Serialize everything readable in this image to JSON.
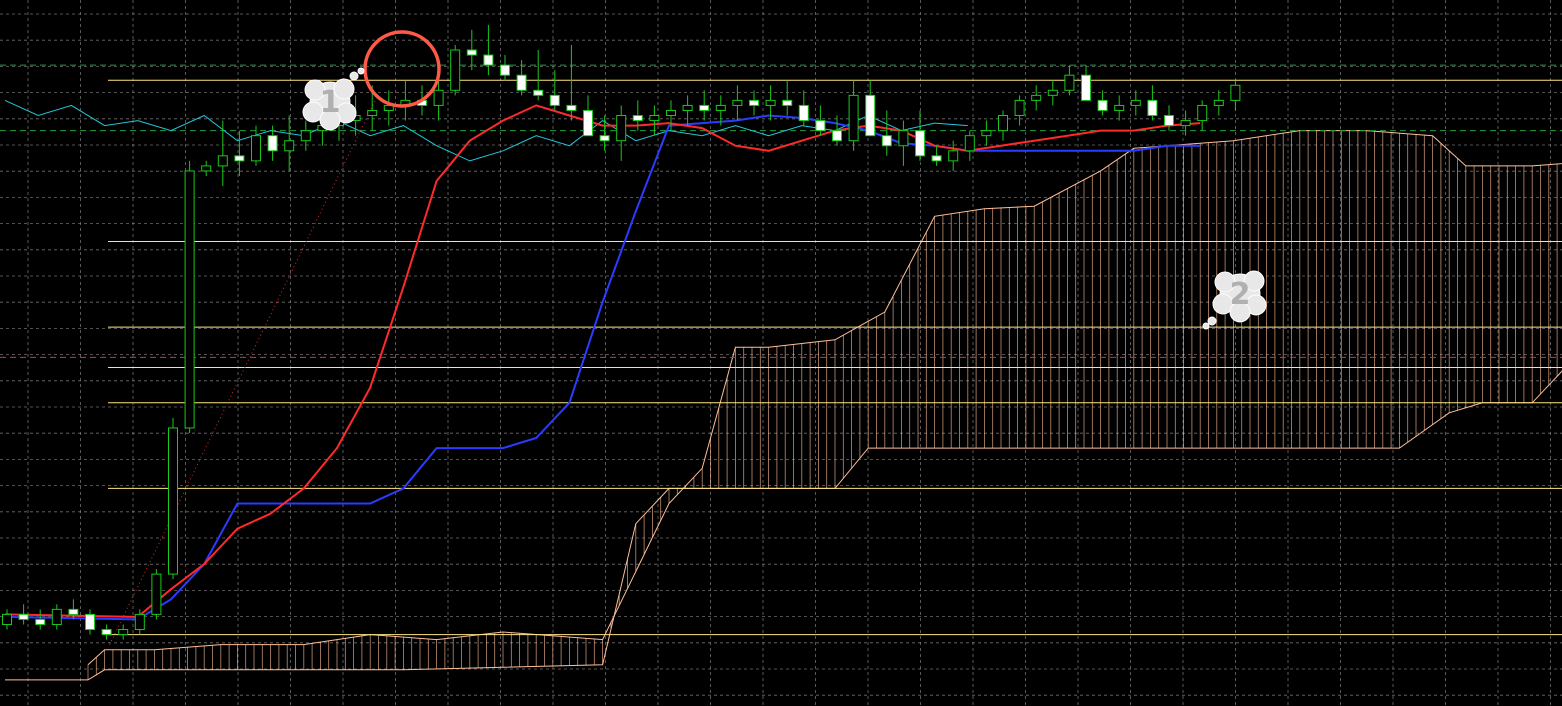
{
  "colors": {
    "background": "#000000",
    "grid": "#8a8a8a",
    "candle_bull_wick": "#19c819",
    "candle_bear_body": "#ffffff",
    "tenkan": "#ff2a2a",
    "kijun": "#2a3cff",
    "chikou": "#26c6da",
    "cloud": "#ffbf99",
    "level_line": "#ffe680",
    "green_dashed": "#1f9e3a",
    "red_dashed": "#e03030",
    "trend_dots": "#cc3322",
    "highlight_circle": "#ff5a47",
    "callout_fill": "#e8e8e8",
    "callout_text": "#b0b0b0"
  },
  "callouts": [
    {
      "label": "1",
      "icon": "thought-bubble-icon"
    },
    {
      "label": "2",
      "icon": "thought-bubble-icon"
    }
  ],
  "chart_data": {
    "type": "candlestick",
    "indicator": "ichimoku",
    "grid": true,
    "candles_index_range": [
      0,
      74
    ],
    "candles": [
      [
        95.1,
        95.4,
        95.0,
        95.3
      ],
      [
        95.3,
        95.5,
        95.1,
        95.2
      ],
      [
        95.2,
        95.4,
        95.0,
        95.1
      ],
      [
        95.1,
        95.5,
        95.0,
        95.4
      ],
      [
        95.4,
        95.6,
        95.2,
        95.3
      ],
      [
        95.3,
        95.4,
        94.9,
        95.0
      ],
      [
        95.0,
        95.1,
        94.8,
        94.9
      ],
      [
        94.9,
        95.1,
        94.8,
        95.0
      ],
      [
        95.0,
        95.4,
        94.9,
        95.3
      ],
      [
        95.3,
        96.2,
        95.2,
        96.1
      ],
      [
        96.1,
        99.2,
        96.0,
        99.0
      ],
      [
        99.0,
        104.3,
        98.9,
        104.1
      ],
      [
        104.1,
        104.3,
        104.0,
        104.2
      ],
      [
        104.2,
        105.1,
        103.8,
        104.4
      ],
      [
        104.4,
        104.9,
        104.0,
        104.3
      ],
      [
        104.3,
        105.0,
        104.2,
        104.8
      ],
      [
        104.8,
        105.0,
        104.3,
        104.5
      ],
      [
        104.5,
        105.2,
        104.1,
        104.7
      ],
      [
        104.7,
        105.1,
        104.5,
        104.9
      ],
      [
        104.9,
        105.3,
        104.6,
        105.0
      ],
      [
        105.0,
        105.3,
        104.7,
        105.1
      ],
      [
        105.1,
        105.6,
        104.8,
        105.2
      ],
      [
        105.2,
        105.8,
        104.9,
        105.3
      ],
      [
        105.3,
        105.7,
        105.0,
        105.4
      ],
      [
        105.4,
        105.9,
        105.1,
        105.5
      ],
      [
        105.5,
        105.8,
        105.2,
        105.4
      ],
      [
        105.4,
        105.9,
        105.1,
        105.7
      ],
      [
        105.7,
        106.6,
        105.6,
        106.5
      ],
      [
        106.5,
        106.9,
        106.1,
        106.4
      ],
      [
        106.4,
        107.0,
        106.0,
        106.2
      ],
      [
        106.2,
        106.4,
        105.9,
        106.0
      ],
      [
        106.0,
        106.3,
        105.6,
        105.7
      ],
      [
        105.7,
        106.5,
        105.5,
        105.6
      ],
      [
        105.6,
        106.1,
        105.3,
        105.4
      ],
      [
        105.4,
        106.6,
        105.1,
        105.3
      ],
      [
        105.3,
        105.6,
        104.9,
        104.8
      ],
      [
        104.8,
        105.2,
        104.5,
        104.7
      ],
      [
        104.7,
        105.4,
        104.3,
        105.2
      ],
      [
        105.2,
        105.5,
        104.9,
        105.1
      ],
      [
        105.1,
        105.4,
        104.8,
        105.2
      ],
      [
        105.2,
        105.5,
        104.9,
        105.3
      ],
      [
        105.3,
        105.6,
        105.0,
        105.4
      ],
      [
        105.4,
        105.7,
        105.1,
        105.3
      ],
      [
        105.3,
        105.6,
        105.0,
        105.4
      ],
      [
        105.4,
        105.8,
        105.1,
        105.5
      ],
      [
        105.5,
        105.7,
        105.2,
        105.4
      ],
      [
        105.4,
        105.8,
        105.1,
        105.5
      ],
      [
        105.5,
        105.9,
        105.2,
        105.4
      ],
      [
        105.4,
        105.7,
        105.0,
        105.1
      ],
      [
        105.1,
        105.4,
        104.8,
        104.9
      ],
      [
        104.9,
        105.2,
        104.6,
        104.7
      ],
      [
        104.7,
        105.9,
        104.5,
        105.6
      ],
      [
        105.6,
        105.9,
        104.9,
        104.8
      ],
      [
        104.8,
        105.3,
        104.4,
        104.6
      ],
      [
        104.6,
        105.1,
        104.2,
        104.9
      ],
      [
        104.9,
        105.3,
        104.3,
        104.4
      ],
      [
        104.4,
        104.6,
        104.2,
        104.3
      ],
      [
        104.3,
        104.7,
        104.1,
        104.5
      ],
      [
        104.5,
        104.9,
        104.3,
        104.8
      ],
      [
        104.8,
        105.1,
        104.6,
        104.9
      ],
      [
        104.9,
        105.3,
        104.7,
        105.2
      ],
      [
        105.2,
        105.6,
        105.0,
        105.5
      ],
      [
        105.5,
        105.8,
        105.3,
        105.6
      ],
      [
        105.6,
        105.9,
        105.4,
        105.7
      ],
      [
        105.7,
        106.2,
        105.6,
        106.0
      ],
      [
        106.0,
        106.2,
        105.5,
        105.5
      ],
      [
        105.5,
        105.7,
        105.2,
        105.3
      ],
      [
        105.3,
        105.6,
        105.1,
        105.4
      ],
      [
        105.4,
        105.7,
        105.2,
        105.5
      ],
      [
        105.5,
        105.8,
        105.1,
        105.2
      ],
      [
        105.2,
        105.4,
        104.9,
        105.0
      ],
      [
        105.0,
        105.3,
        104.8,
        105.1
      ],
      [
        105.1,
        105.5,
        104.9,
        105.4
      ],
      [
        105.4,
        105.7,
        105.2,
        105.5
      ],
      [
        105.5,
        105.9,
        105.3,
        105.8
      ]
    ],
    "tenkan_points": [
      [
        0,
        95.3
      ],
      [
        8,
        95.25
      ],
      [
        10,
        95.8
      ],
      [
        12,
        96.3
      ],
      [
        14,
        97.0
      ],
      [
        16,
        97.3
      ],
      [
        18,
        97.8
      ],
      [
        20,
        98.6
      ],
      [
        22,
        99.8
      ],
      [
        24,
        101.8
      ],
      [
        26,
        103.9
      ],
      [
        28,
        104.7
      ],
      [
        30,
        105.1
      ],
      [
        32,
        105.4
      ],
      [
        34,
        105.2
      ],
      [
        36,
        105.0
      ],
      [
        38,
        105.0
      ],
      [
        40,
        105.05
      ],
      [
        42,
        104.95
      ],
      [
        44,
        104.6
      ],
      [
        46,
        104.5
      ],
      [
        48,
        104.7
      ],
      [
        50,
        104.9
      ],
      [
        52,
        105.0
      ],
      [
        54,
        104.9
      ],
      [
        56,
        104.6
      ],
      [
        58,
        104.5
      ],
      [
        60,
        104.6
      ],
      [
        62,
        104.7
      ],
      [
        64,
        104.8
      ],
      [
        66,
        104.9
      ],
      [
        68,
        104.9
      ],
      [
        70,
        105.0
      ],
      [
        72,
        105.05
      ]
    ],
    "kijun_points": [
      [
        0,
        95.25
      ],
      [
        8,
        95.2
      ],
      [
        10,
        95.6
      ],
      [
        12,
        96.3
      ],
      [
        14,
        97.5
      ],
      [
        16,
        97.5
      ],
      [
        18,
        97.5
      ],
      [
        20,
        97.5
      ],
      [
        22,
        97.5
      ],
      [
        24,
        97.8
      ],
      [
        26,
        98.6
      ],
      [
        28,
        98.6
      ],
      [
        30,
        98.6
      ],
      [
        32,
        98.8
      ],
      [
        34,
        99.5
      ],
      [
        36,
        101.5
      ],
      [
        38,
        103.3
      ],
      [
        40,
        105.0
      ],
      [
        42,
        105.05
      ],
      [
        44,
        105.1
      ],
      [
        46,
        105.2
      ],
      [
        48,
        105.15
      ],
      [
        50,
        105.05
      ],
      [
        52,
        104.9
      ],
      [
        54,
        104.65
      ],
      [
        56,
        104.6
      ],
      [
        58,
        104.5
      ],
      [
        60,
        104.5
      ],
      [
        62,
        104.5
      ],
      [
        64,
        104.5
      ],
      [
        66,
        104.5
      ],
      [
        68,
        104.5
      ],
      [
        70,
        104.6
      ],
      [
        72,
        104.6
      ]
    ],
    "chikou_points": [
      [
        0,
        105.5
      ],
      [
        2,
        105.2
      ],
      [
        4,
        105.4
      ],
      [
        6,
        105.0
      ],
      [
        8,
        105.1
      ],
      [
        10,
        104.9
      ],
      [
        12,
        105.2
      ],
      [
        14,
        104.7
      ],
      [
        16,
        104.9
      ],
      [
        18,
        104.8
      ],
      [
        20,
        105.1
      ],
      [
        22,
        104.8
      ],
      [
        24,
        105.0
      ],
      [
        26,
        104.6
      ],
      [
        28,
        104.3
      ],
      [
        30,
        104.5
      ],
      [
        32,
        104.8
      ],
      [
        34,
        104.6
      ],
      [
        36,
        105.1
      ],
      [
        38,
        104.7
      ],
      [
        40,
        104.9
      ],
      [
        42,
        104.8
      ],
      [
        44,
        105.0
      ],
      [
        46,
        104.8
      ],
      [
        48,
        105.0
      ],
      [
        50,
        104.9
      ],
      [
        52,
        105.2
      ],
      [
        54,
        104.9
      ],
      [
        56,
        105.05
      ],
      [
        58,
        105.0
      ]
    ],
    "cloud_upper": [
      [
        5,
        94.3
      ],
      [
        6,
        94.6
      ],
      [
        9,
        94.6
      ],
      [
        13,
        94.7
      ],
      [
        18,
        94.7
      ],
      [
        22,
        94.9
      ],
      [
        26,
        94.8
      ],
      [
        30,
        94.95
      ],
      [
        36,
        94.8
      ],
      [
        40,
        97.5
      ],
      [
        42,
        98.2
      ],
      [
        44,
        100.6
      ],
      [
        46,
        100.6
      ],
      [
        50,
        100.75
      ],
      [
        53,
        101.3
      ],
      [
        56,
        103.2
      ],
      [
        59,
        103.35
      ],
      [
        62,
        103.4
      ],
      [
        66,
        104.1
      ],
      [
        68,
        104.55
      ],
      [
        70,
        104.6
      ],
      [
        74,
        104.7
      ],
      [
        78,
        104.9
      ],
      [
        82,
        104.9
      ],
      [
        86,
        104.8
      ],
      [
        88,
        104.2
      ],
      [
        92,
        104.2
      ],
      [
        96,
        104.3
      ],
      [
        100,
        104.35
      ],
      [
        104,
        104.35
      ]
    ],
    "cloud_lower": [
      [
        0,
        94.0
      ],
      [
        5,
        94.0
      ],
      [
        6,
        94.2
      ],
      [
        24,
        94.2
      ],
      [
        36,
        94.3
      ],
      [
        38,
        97.1
      ],
      [
        40,
        97.8
      ],
      [
        50,
        97.8
      ],
      [
        52,
        98.6
      ],
      [
        60,
        98.6
      ],
      [
        84,
        98.6
      ],
      [
        87,
        99.3
      ],
      [
        89,
        99.5
      ],
      [
        92,
        99.5
      ],
      [
        94,
        100.2
      ],
      [
        104,
        100.2
      ]
    ],
    "level_lines": [
      105.9,
      102.7,
      101.0,
      100.2,
      99.5,
      97.8,
      94.9
    ],
    "dashed_green": [
      106.2,
      104.9
    ],
    "dashed_red": 100.4
  }
}
